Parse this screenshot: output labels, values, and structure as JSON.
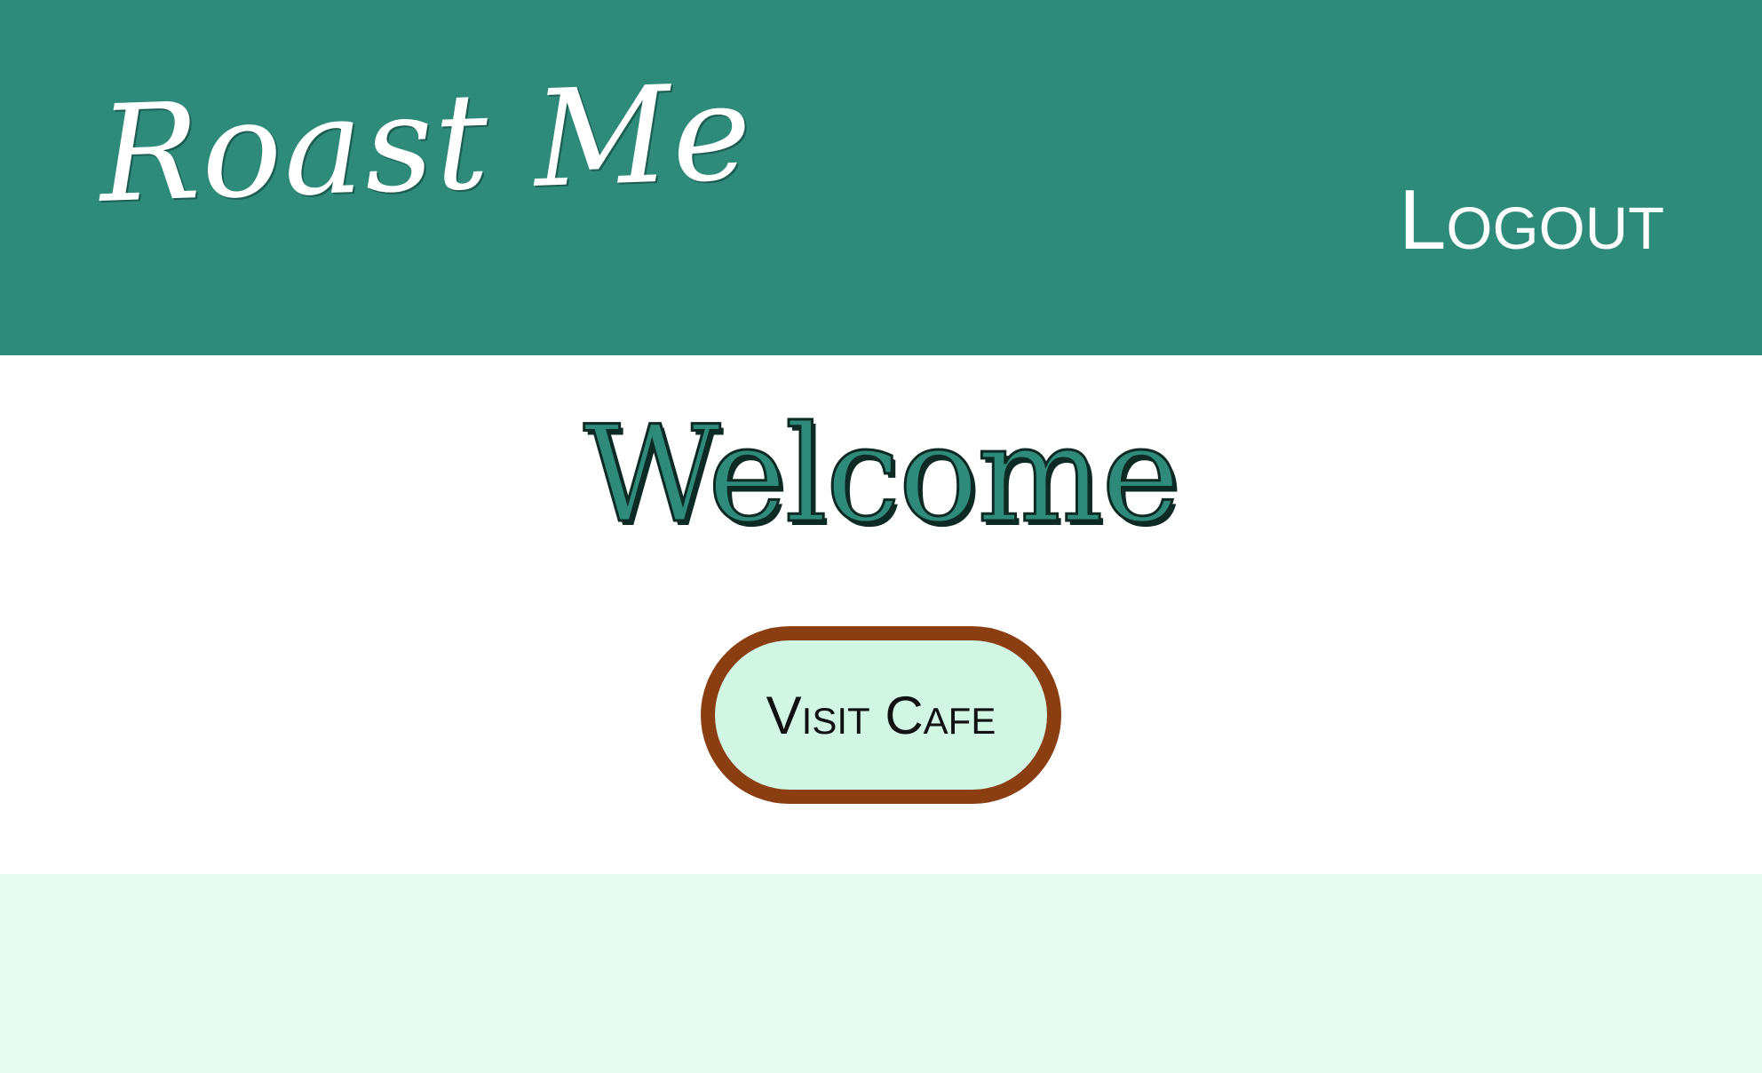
{
  "header": {
    "brand_title": "Roast Me",
    "logout_label": "Logout"
  },
  "main": {
    "heading": "Welcome",
    "visit_button_label": "Visit Cafe"
  },
  "colors": {
    "header_bg": "#2e8b7a",
    "footer_bg": "#e8fbf2",
    "button_bg": "#d1f7e4",
    "button_border": "#8b3e12",
    "heading_fill": "#2e8b7a"
  }
}
